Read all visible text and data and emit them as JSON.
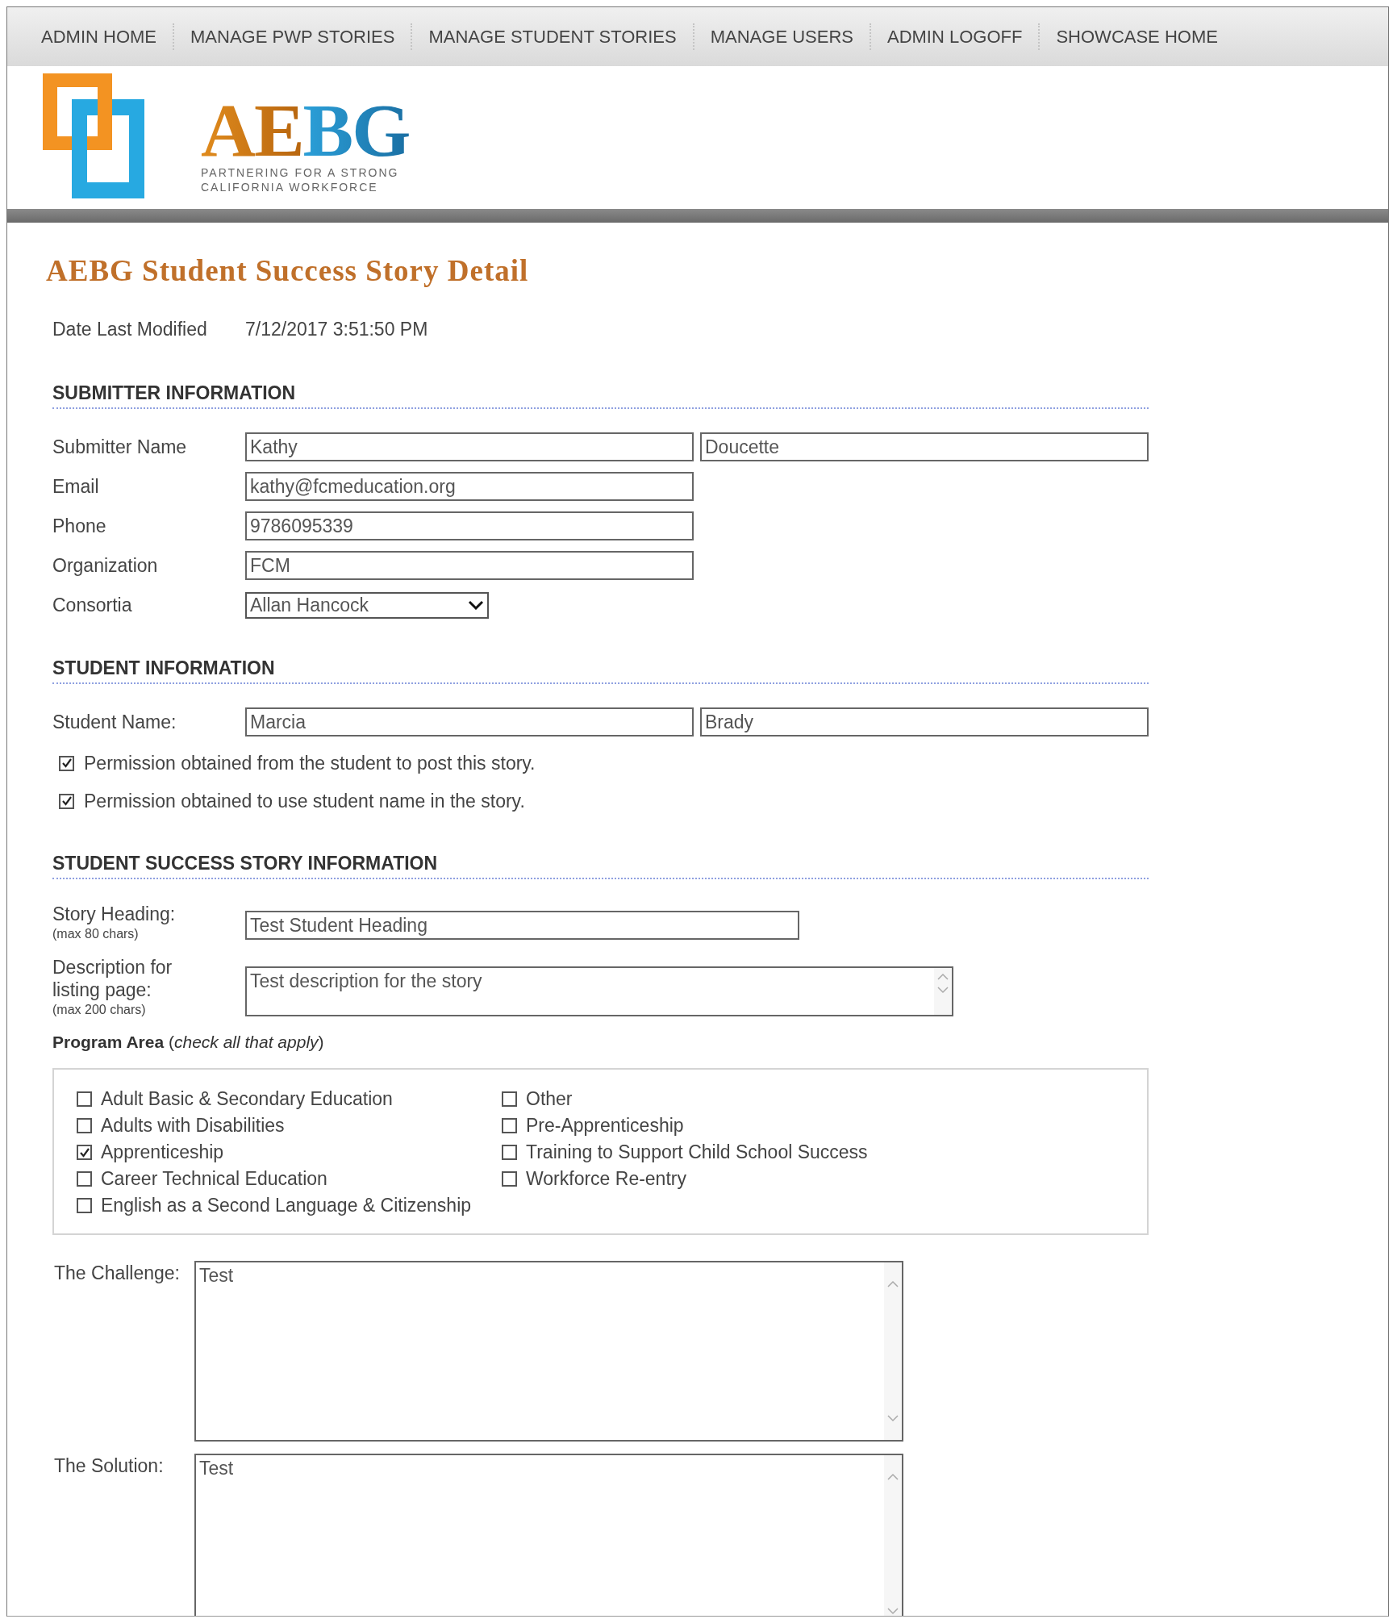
{
  "nav": [
    "ADMIN HOME",
    "MANAGE PWP STORIES",
    "MANAGE STUDENT STORIES",
    "MANAGE USERS",
    "ADMIN LOGOFF",
    "SHOWCASE HOME"
  ],
  "logo": {
    "wordmark": "AEBG",
    "tagline": [
      "PARTNERING FOR A STRONG",
      "CALIFORNIA WORKFORCE"
    ]
  },
  "page_title": "AEBG Student Success Story Detail",
  "date_modified": {
    "label": "Date Last Modified",
    "value": "7/12/2017 3:51:50 PM"
  },
  "sections": [
    {
      "heading": "SUBMITTER INFORMATION",
      "rows": [
        {
          "kind": "name",
          "label": "Submitter Name",
          "values": [
            "Kathy",
            "Doucette"
          ]
        },
        {
          "kind": "text",
          "label": "Email",
          "value": "kathy@fcmeducation.org"
        },
        {
          "kind": "text",
          "label": "Phone",
          "value": "9786095339"
        },
        {
          "kind": "text",
          "label": "Organization",
          "value": "FCM"
        },
        {
          "kind": "select",
          "label": "Consortia",
          "value": "Allan Hancock"
        }
      ]
    },
    {
      "heading": "STUDENT INFORMATION",
      "rows": [
        {
          "kind": "name",
          "label": "Student Name:",
          "values": [
            "Marcia",
            "Brady"
          ]
        },
        {
          "kind": "check",
          "label": "Permission obtained from the student to post this story.",
          "checked": true
        },
        {
          "kind": "check",
          "label": "Permission obtained to use student name in the story.",
          "checked": true
        }
      ]
    },
    {
      "heading": "STUDENT SUCCESS STORY INFORMATION",
      "rows": [
        {
          "kind": "long_text",
          "label": "Story Heading:",
          "note": "(max 80 chars)",
          "value": "Test Student Heading"
        },
        {
          "kind": "short_area",
          "label": "Description for listing page:",
          "note": "(max 200 chars)",
          "value": "Test description for the story"
        }
      ]
    }
  ],
  "program_area": {
    "label": "**Program Area** (*check all that apply*)",
    "columns": [
      [
        {
          "label": "Adult Basic & Secondary Education",
          "checked": false
        },
        {
          "label": "Adults with Disabilities",
          "checked": false
        },
        {
          "label": "Apprenticeship",
          "checked": true
        },
        {
          "label": "Career Technical Education",
          "checked": false
        },
        {
          "label": "English as a Second Language & Citizenship",
          "checked": false
        }
      ],
      [
        {
          "label": "Other",
          "checked": false
        },
        {
          "label": "Pre-Apprenticeship",
          "checked": false
        },
        {
          "label": "Training to Support Child School Success",
          "checked": false
        },
        {
          "label": "Workforce Re-entry",
          "checked": false
        }
      ]
    ]
  },
  "essays": [
    {
      "label": "The Challenge:",
      "value": "Test"
    },
    {
      "label": "The Solution:",
      "value": "Test"
    }
  ]
}
